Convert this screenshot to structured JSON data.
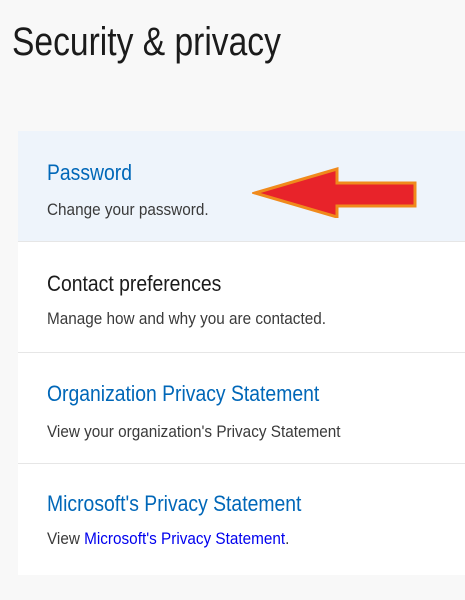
{
  "page": {
    "title": "Security & privacy"
  },
  "items": [
    {
      "label": "Password",
      "description": "Change your password."
    },
    {
      "label": "Contact preferences",
      "description": "Manage how and why you are contacted."
    },
    {
      "label": "Organization Privacy Statement",
      "description": "View your organization's Privacy Statement"
    },
    {
      "label": "Microsoft's Privacy Statement",
      "description_prefix": "View ",
      "description_link": "Microsoft's Privacy Statement",
      "description_suffix": "."
    }
  ],
  "annotation": {
    "icon": "red-arrow-left",
    "color": "#e8232a",
    "outline_color": "#f08a1c"
  },
  "colors": {
    "link": "#0067b8",
    "inline_link": "#0000ee",
    "selected_background": "#eef4fb"
  }
}
